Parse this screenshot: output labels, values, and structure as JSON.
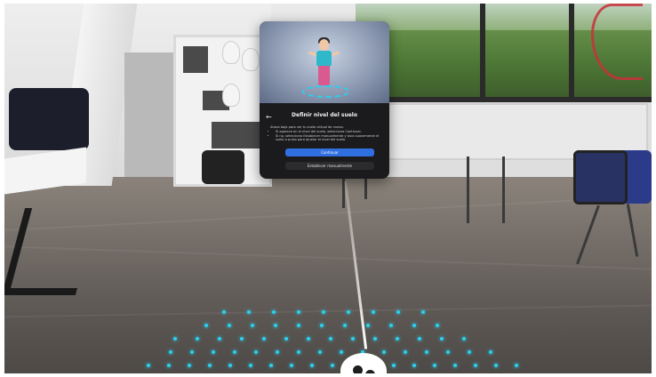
{
  "dialog": {
    "title": "Definir nivel del suelo",
    "intro": "Ahora baja para ver tu suelo virtual de nuevo.",
    "bullets": [
      "Si aparece en el nivel del suelo, selecciona Continuar.",
      "Si no, selecciona Establecer manualmente y toca suavemente el suelo o pulsa para ajustar el nivel del suelo."
    ],
    "primary_button": "Continuar",
    "secondary_button": "Establecer manualmente"
  },
  "icons": {
    "back": "arrow-left-icon",
    "controller": "controller-icon"
  },
  "colors": {
    "primary": "#2f6fe0",
    "guardian": "#2ad0ee",
    "panel": "#1b1b1d"
  }
}
